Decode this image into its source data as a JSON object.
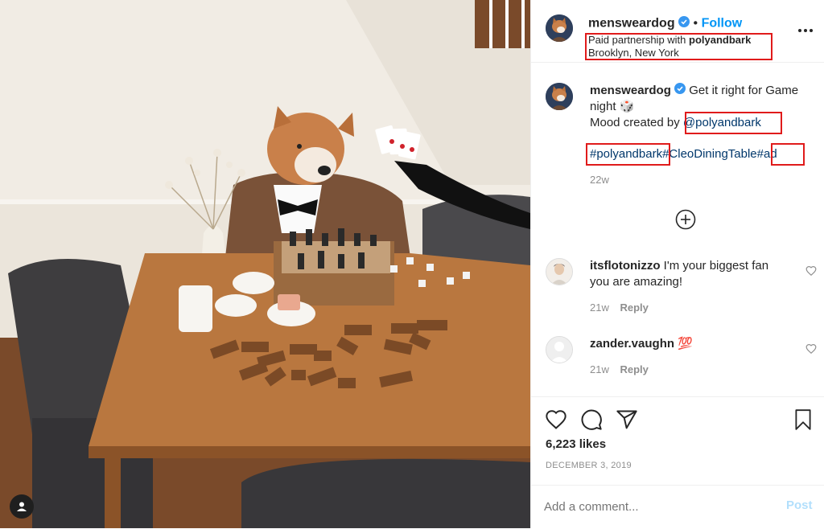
{
  "post": {
    "username": "mensweardog",
    "separator": "•",
    "follow_label": "Follow",
    "partnership_prefix": "Paid partnership with",
    "partner": "polyandbark",
    "location": "Brooklyn, New York",
    "more_icon": "more-horizontal-icon"
  },
  "caption": {
    "username": "mensweardog",
    "line1": "Get it right for Game",
    "line2": "night 🎲",
    "mood_prefix": "Mood created by",
    "mention": "@polyandbark",
    "hashtag1": "#polyandbark",
    "hashtag2": "#CleoDiningTable",
    "hashtag3": "#ad",
    "age": "22w",
    "load_more_icon": "plus-circle-icon"
  },
  "comments": [
    {
      "username": "itsflotonizzo",
      "text_line1": "I'm your biggest fan",
      "text_line2": "you are amazing!",
      "age": "21w",
      "reply_label": "Reply"
    },
    {
      "username": "zander.vaughn",
      "text_line1": "💯",
      "age": "21w",
      "reply_label": "Reply"
    }
  ],
  "actions": {
    "like_icon": "heart-icon",
    "comment_icon": "comment-icon",
    "share_icon": "share-icon",
    "save_icon": "bookmark-icon",
    "likes": "6,223 likes",
    "date": "DECEMBER 3, 2019"
  },
  "comment_box": {
    "placeholder": "Add a comment...",
    "post_label": "Post"
  },
  "colors": {
    "follow_blue": "#0095f6",
    "link_navy": "#00376b",
    "highlight_red": "#e01b1b",
    "post_disabled": "#b2dffc"
  }
}
